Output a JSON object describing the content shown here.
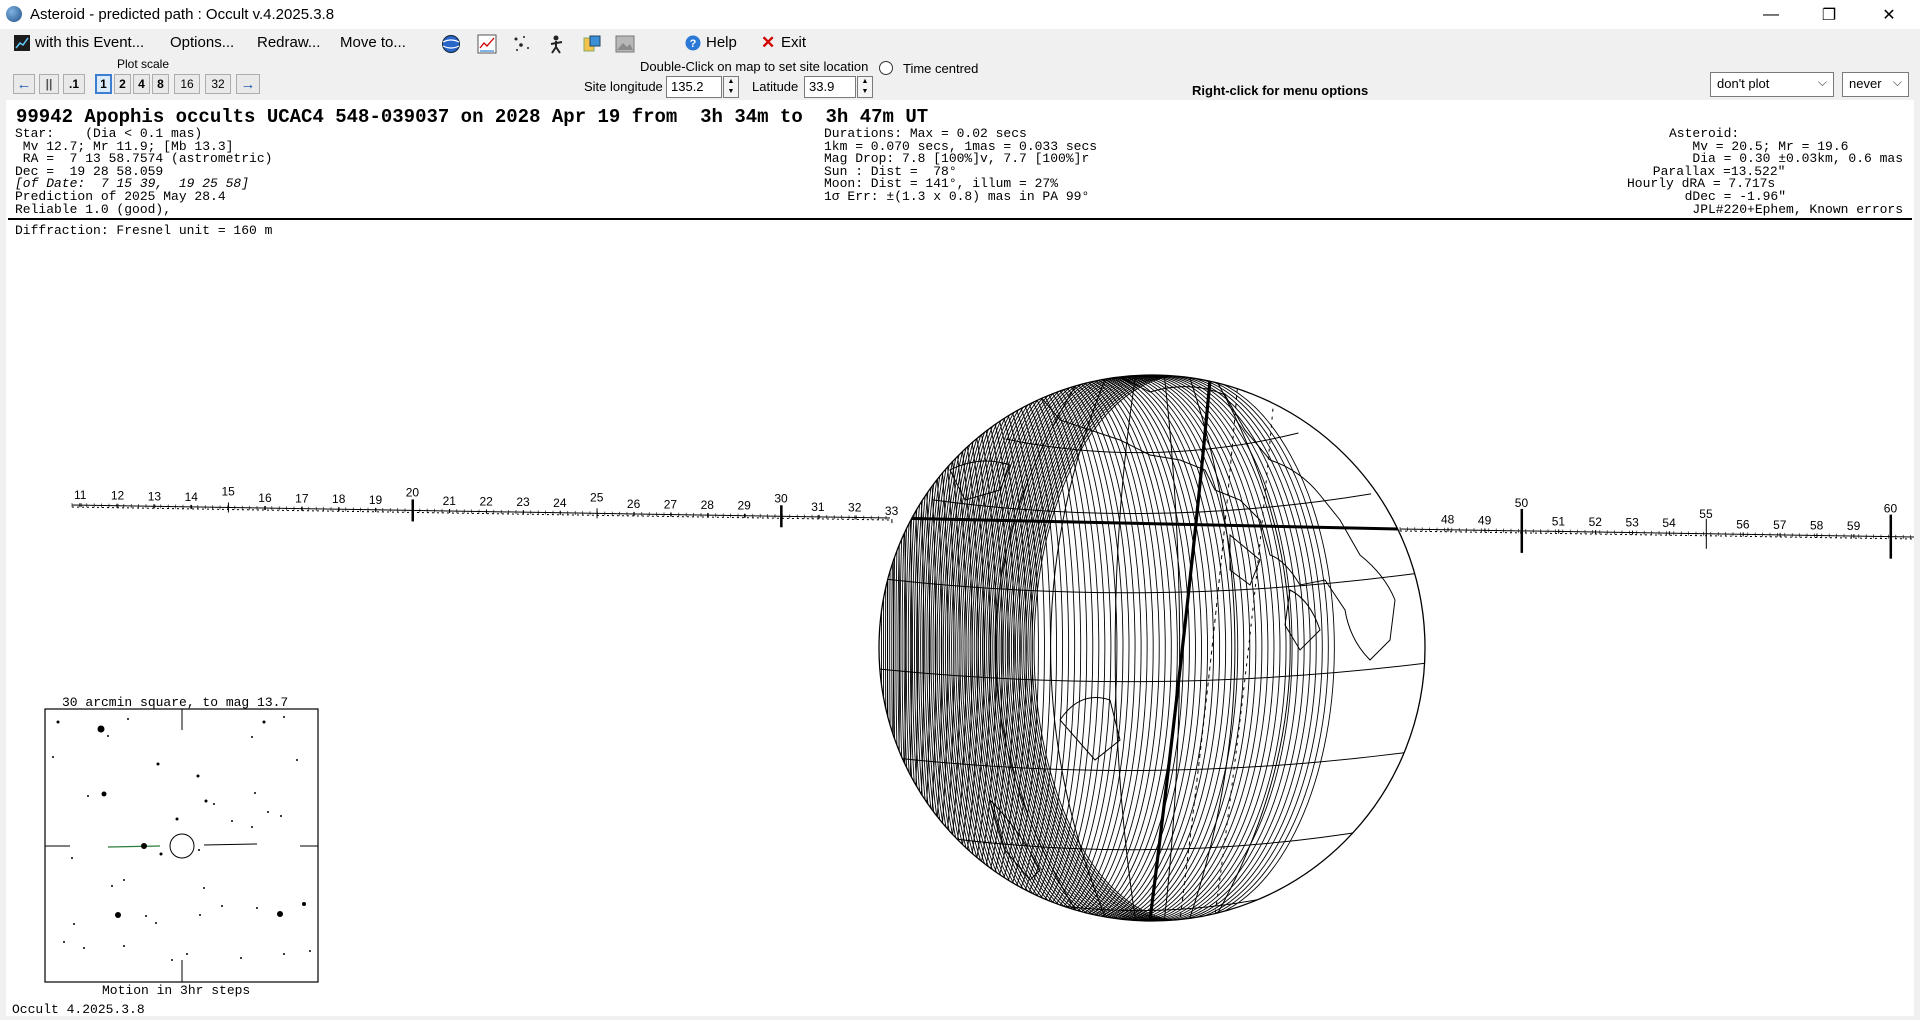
{
  "window": {
    "title": "Asteroid - predicted path : Occult v.4.2025.3.8",
    "minimize": "—",
    "maximize": "❐",
    "close": "✕"
  },
  "menu": {
    "with_event": "with this Event...",
    "options": "Options...",
    "redraw": "Redraw...",
    "move_to": "Move to...",
    "help": "Help",
    "exit": "Exit"
  },
  "toolbar": {
    "plot_scale_label": "Plot scale",
    "scale_buttons": [
      ".1",
      "1",
      "2",
      "4",
      "8",
      "16",
      "32"
    ],
    "selected_scale": "1",
    "double_click_hint": "Double-Click on map to set site location",
    "time_centred": "Time centred",
    "site_longitude_label": "Site longitude",
    "site_longitude": "135.2",
    "latitude_label": "Latitude",
    "latitude": "33.9",
    "right_click_hint": "Right-click for menu options",
    "plot_dropdown": "don't plot",
    "never_dropdown": "never"
  },
  "event": {
    "headline": "99942 Apophis occults UCAC4 548-039037 on 2028 Apr 19 from  3h 34m to  3h 47m UT",
    "star_lines": [
      "Star:    (Dia < 0.1 mas)",
      " Mv 12.7; Mr 11.9; [Mb 13.3]",
      " RA =  7 13 58.7574 (astrometric)",
      "Dec =  19 28 58.059",
      "[of Date:  7 15 39,  19 25 58]",
      "Prediction of 2025 May 28.4",
      "Reliable 1.0 (good),"
    ],
    "duration_lines": [
      "Durations: Max = 0.02 secs",
      "1km = 0.070 secs, 1mas = 0.033 secs",
      "Mag Drop: 7.8 [100%]v, 7.7 [100%]r",
      "Sun : Dist =  78°",
      "Moon: Dist = 141°, illum = 27%",
      "1σ Err: ±(1.3 x 0.8) mas in PA 99°"
    ],
    "asteroid_lines": [
      "Asteroid:",
      "   Mv = 20.5; Mr = 19.6",
      "   Dia = 0.30 ±0.03km, 0.6 mas",
      " Parallax =13.522\"",
      "Hourly dRA = 7.717s",
      "  dDec = -1.96\"",
      "   JPL#220+Ephem, Known errors"
    ],
    "diffraction": "Diffraction: Fresnel unit = 160 m"
  },
  "track_labels": {
    "left": [
      "11",
      "12",
      "13",
      "14",
      "15",
      "16",
      "17",
      "18",
      "19",
      "20",
      "21",
      "22",
      "23",
      "24",
      "25",
      "26",
      "27",
      "28",
      "29",
      "30",
      "31",
      "32",
      "33"
    ],
    "right": [
      "48",
      "49",
      "50",
      "51",
      "52",
      "53",
      "54",
      "55",
      "56",
      "57",
      "58",
      "59",
      "60"
    ]
  },
  "starchart": {
    "title": "30 arcmin square, to mag 13.7",
    "caption": "Motion in 3hr steps"
  },
  "status": "Occult 4.2025.3.8"
}
